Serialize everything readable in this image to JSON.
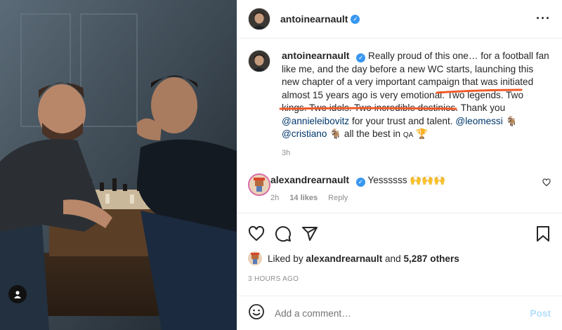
{
  "post": {
    "author": "antoinearnault",
    "verified": true
  },
  "caption": {
    "author": "antoinearnault",
    "text_before": "Really proud of this one… for a football fan like me, and the day before a new WC starts, launching this new chapter of a very important campaign that was initiated almost 15 years ago is very emotional.",
    "text_highlight": "Two legends. Two kings. Two idols. Two incredible destinies.",
    "text_after": "Thank you",
    "mention_1": "@annieleibovitz",
    "text_mid": "for your trust and talent.",
    "mention_2": "@leomessi",
    "mention_3": "@cristiano",
    "text_end": "all the best in",
    "qa_text": "QA",
    "time": "3h",
    "highlight_color": "#f05a28"
  },
  "reply": {
    "author": "alexandrearnault",
    "text": "Yessssss 🙌🙌🙌",
    "time": "2h",
    "likes": "14 likes",
    "reply_label": "Reply"
  },
  "likes": {
    "prefix": "Liked by",
    "user": "alexandrearnault",
    "and": "and",
    "count": "5,287 others"
  },
  "timestamp": "3 HOURS AGO",
  "comment_box": {
    "placeholder": "Add a comment…",
    "post_label": "Post"
  },
  "icons": {
    "more": "more-icon",
    "heart": "heart-icon",
    "comment": "comment-icon",
    "share": "share-icon",
    "save": "bookmark-icon",
    "emoji": "emoji-icon",
    "user_tag": "user-tag-icon"
  }
}
